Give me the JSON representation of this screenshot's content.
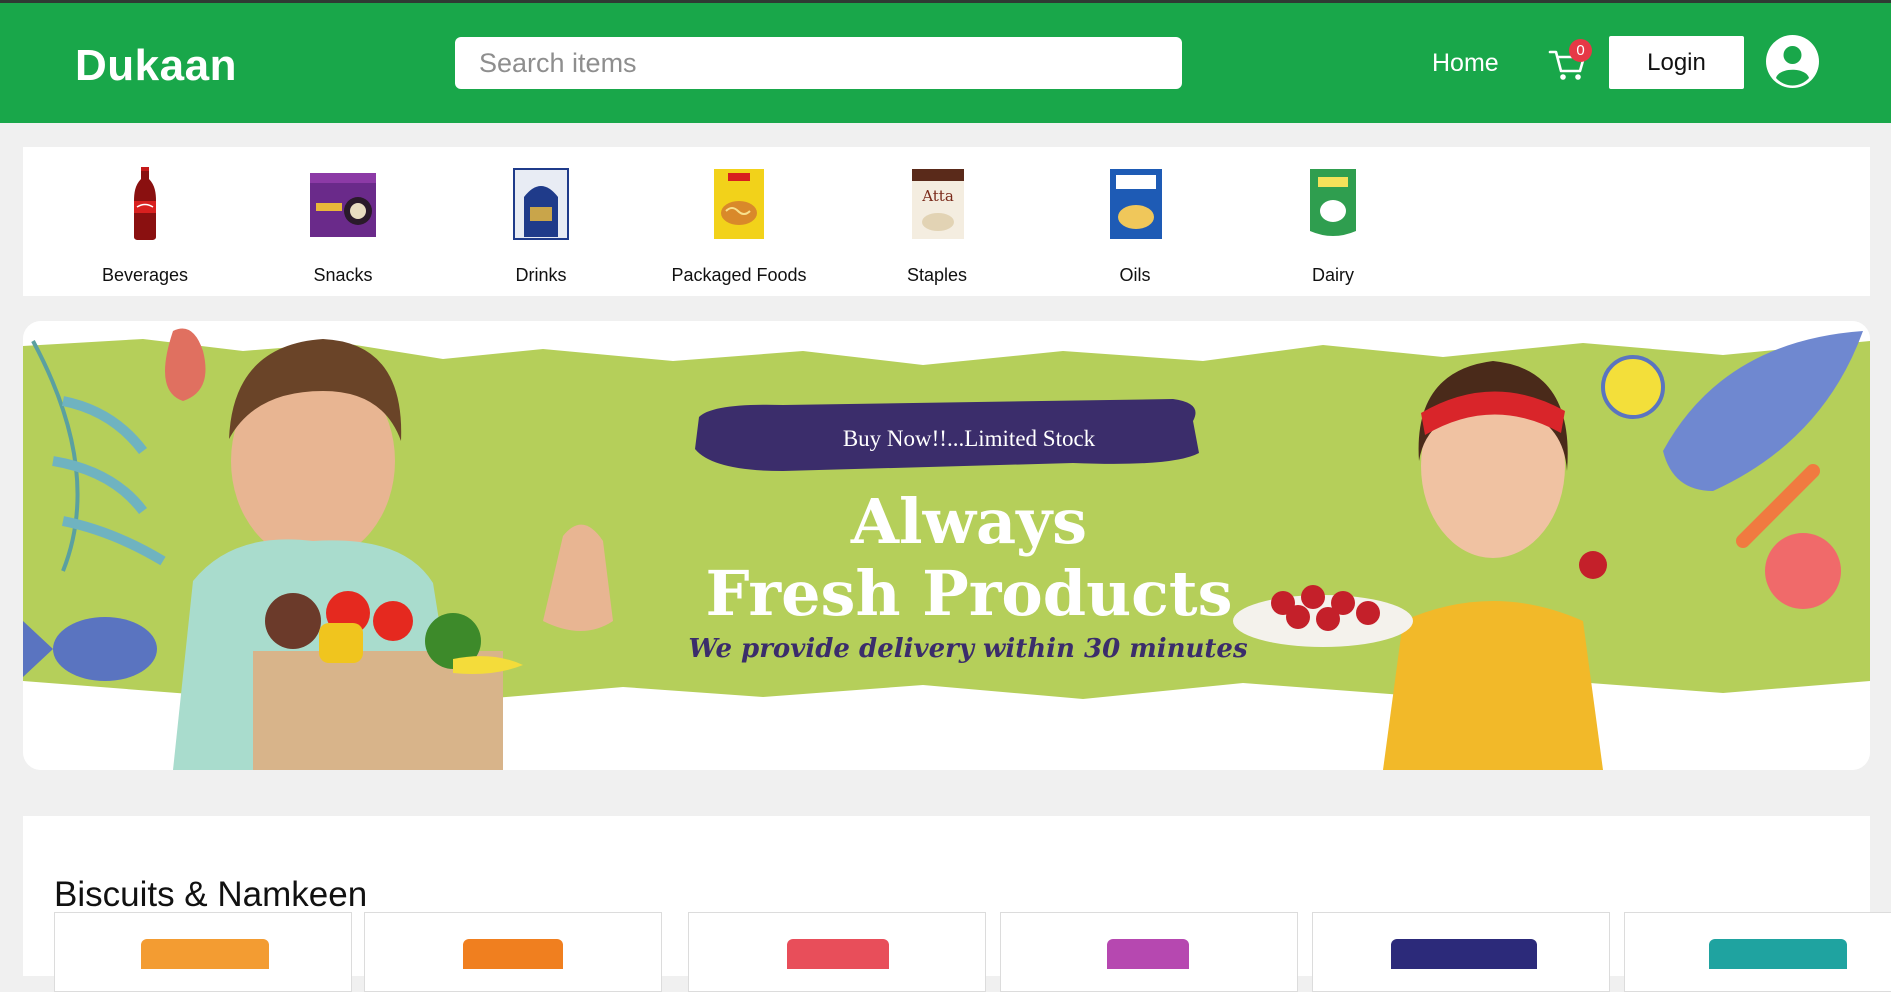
{
  "header": {
    "logo": "Dukaan",
    "search_placeholder": "Search items",
    "nav_home": "Home",
    "cart_count": "0",
    "login_label": "Login",
    "brand_color": "#19a74a"
  },
  "categories": [
    {
      "label": "Beverages",
      "icon": "cola-bottle-icon"
    },
    {
      "label": "Snacks",
      "icon": "snack-box-icon"
    },
    {
      "label": "Drinks",
      "icon": "tea-box-icon"
    },
    {
      "label": "Packaged Foods",
      "icon": "noodles-pack-icon"
    },
    {
      "label": "Staples",
      "icon": "atta-pack-icon"
    },
    {
      "label": "Oils",
      "icon": "oil-pack-icon"
    },
    {
      "label": "Dairy",
      "icon": "milk-pack-icon"
    }
  ],
  "banner": {
    "tag": "Buy Now!!...Limited Stock",
    "title_line1": "Always",
    "title_line2": "Fresh Products",
    "subtitle": "We provide delivery within 30 minutes",
    "background_color": "#b5cf5a",
    "tag_color": "#3b2d6b"
  },
  "section": {
    "title": "Biscuits & Namkeen",
    "products": [
      {
        "color": "#f39c32"
      },
      {
        "color": "#f07f1f"
      },
      {
        "color": "#e84e5a"
      },
      {
        "color": "#b648b0"
      },
      {
        "color": "#2c2a7a"
      },
      {
        "color": "#1fa3a0"
      }
    ]
  }
}
